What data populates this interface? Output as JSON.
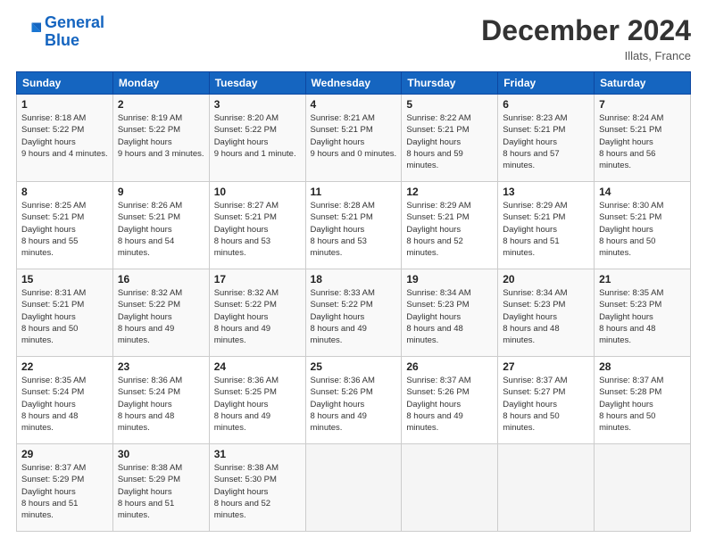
{
  "logo": {
    "line1": "General",
    "line2": "Blue"
  },
  "title": "December 2024",
  "location": "Illats, France",
  "weekdays": [
    "Sunday",
    "Monday",
    "Tuesday",
    "Wednesday",
    "Thursday",
    "Friday",
    "Saturday"
  ],
  "weeks": [
    [
      {
        "day": "1",
        "sunrise": "8:18 AM",
        "sunset": "5:22 PM",
        "daylight": "9 hours and 4 minutes."
      },
      {
        "day": "2",
        "sunrise": "8:19 AM",
        "sunset": "5:22 PM",
        "daylight": "9 hours and 3 minutes."
      },
      {
        "day": "3",
        "sunrise": "8:20 AM",
        "sunset": "5:22 PM",
        "daylight": "9 hours and 1 minute."
      },
      {
        "day": "4",
        "sunrise": "8:21 AM",
        "sunset": "5:21 PM",
        "daylight": "9 hours and 0 minutes."
      },
      {
        "day": "5",
        "sunrise": "8:22 AM",
        "sunset": "5:21 PM",
        "daylight": "8 hours and 59 minutes."
      },
      {
        "day": "6",
        "sunrise": "8:23 AM",
        "sunset": "5:21 PM",
        "daylight": "8 hours and 57 minutes."
      },
      {
        "day": "7",
        "sunrise": "8:24 AM",
        "sunset": "5:21 PM",
        "daylight": "8 hours and 56 minutes."
      }
    ],
    [
      {
        "day": "8",
        "sunrise": "8:25 AM",
        "sunset": "5:21 PM",
        "daylight": "8 hours and 55 minutes."
      },
      {
        "day": "9",
        "sunrise": "8:26 AM",
        "sunset": "5:21 PM",
        "daylight": "8 hours and 54 minutes."
      },
      {
        "day": "10",
        "sunrise": "8:27 AM",
        "sunset": "5:21 PM",
        "daylight": "8 hours and 53 minutes."
      },
      {
        "day": "11",
        "sunrise": "8:28 AM",
        "sunset": "5:21 PM",
        "daylight": "8 hours and 53 minutes."
      },
      {
        "day": "12",
        "sunrise": "8:29 AM",
        "sunset": "5:21 PM",
        "daylight": "8 hours and 52 minutes."
      },
      {
        "day": "13",
        "sunrise": "8:29 AM",
        "sunset": "5:21 PM",
        "daylight": "8 hours and 51 minutes."
      },
      {
        "day": "14",
        "sunrise": "8:30 AM",
        "sunset": "5:21 PM",
        "daylight": "8 hours and 50 minutes."
      }
    ],
    [
      {
        "day": "15",
        "sunrise": "8:31 AM",
        "sunset": "5:21 PM",
        "daylight": "8 hours and 50 minutes."
      },
      {
        "day": "16",
        "sunrise": "8:32 AM",
        "sunset": "5:22 PM",
        "daylight": "8 hours and 49 minutes."
      },
      {
        "day": "17",
        "sunrise": "8:32 AM",
        "sunset": "5:22 PM",
        "daylight": "8 hours and 49 minutes."
      },
      {
        "day": "18",
        "sunrise": "8:33 AM",
        "sunset": "5:22 PM",
        "daylight": "8 hours and 49 minutes."
      },
      {
        "day": "19",
        "sunrise": "8:34 AM",
        "sunset": "5:23 PM",
        "daylight": "8 hours and 48 minutes."
      },
      {
        "day": "20",
        "sunrise": "8:34 AM",
        "sunset": "5:23 PM",
        "daylight": "8 hours and 48 minutes."
      },
      {
        "day": "21",
        "sunrise": "8:35 AM",
        "sunset": "5:23 PM",
        "daylight": "8 hours and 48 minutes."
      }
    ],
    [
      {
        "day": "22",
        "sunrise": "8:35 AM",
        "sunset": "5:24 PM",
        "daylight": "8 hours and 48 minutes."
      },
      {
        "day": "23",
        "sunrise": "8:36 AM",
        "sunset": "5:24 PM",
        "daylight": "8 hours and 48 minutes."
      },
      {
        "day": "24",
        "sunrise": "8:36 AM",
        "sunset": "5:25 PM",
        "daylight": "8 hours and 49 minutes."
      },
      {
        "day": "25",
        "sunrise": "8:36 AM",
        "sunset": "5:26 PM",
        "daylight": "8 hours and 49 minutes."
      },
      {
        "day": "26",
        "sunrise": "8:37 AM",
        "sunset": "5:26 PM",
        "daylight": "8 hours and 49 minutes."
      },
      {
        "day": "27",
        "sunrise": "8:37 AM",
        "sunset": "5:27 PM",
        "daylight": "8 hours and 50 minutes."
      },
      {
        "day": "28",
        "sunrise": "8:37 AM",
        "sunset": "5:28 PM",
        "daylight": "8 hours and 50 minutes."
      }
    ],
    [
      {
        "day": "29",
        "sunrise": "8:37 AM",
        "sunset": "5:29 PM",
        "daylight": "8 hours and 51 minutes."
      },
      {
        "day": "30",
        "sunrise": "8:38 AM",
        "sunset": "5:29 PM",
        "daylight": "8 hours and 51 minutes."
      },
      {
        "day": "31",
        "sunrise": "8:38 AM",
        "sunset": "5:30 PM",
        "daylight": "8 hours and 52 minutes."
      },
      null,
      null,
      null,
      null
    ]
  ]
}
